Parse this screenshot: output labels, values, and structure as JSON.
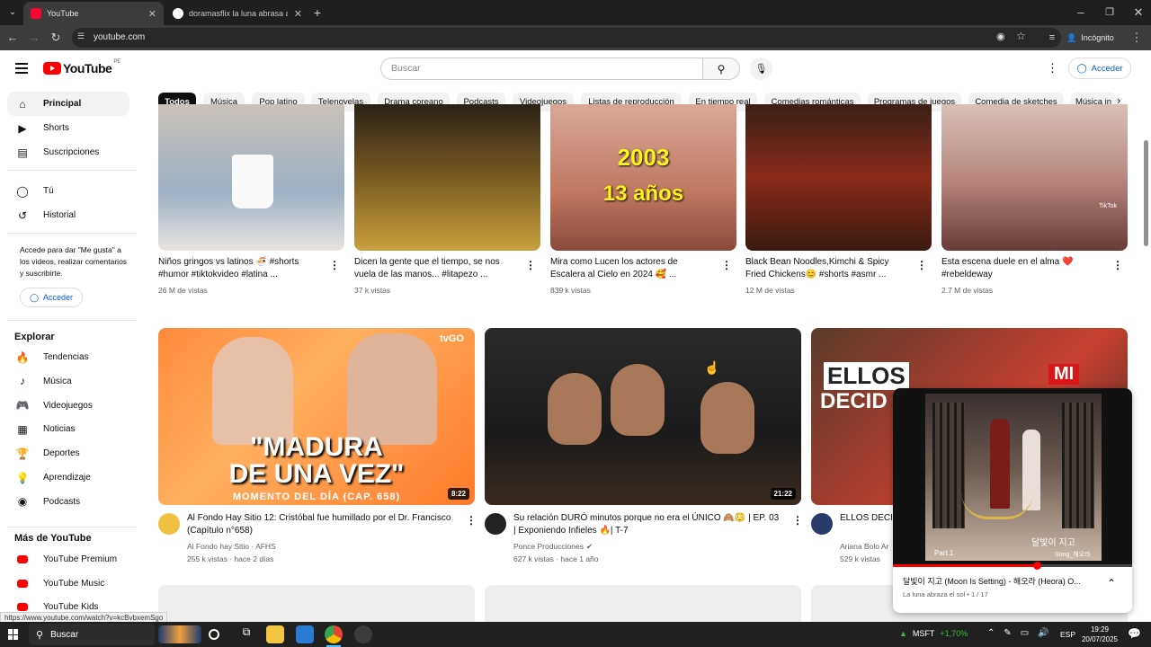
{
  "browser": {
    "tabs": [
      {
        "title": "YouTube",
        "active": true
      },
      {
        "title": "doramasflix la luna abrasa al so",
        "active": false
      }
    ],
    "url": "youtube.com",
    "profile": "Incógnito"
  },
  "header": {
    "logo_text": "YouTube",
    "country": "PE",
    "search_placeholder": "Buscar",
    "signin_label": "Acceder"
  },
  "sidebar": {
    "top": [
      {
        "label": "Principal",
        "icon": "home-icon",
        "selected": true
      },
      {
        "label": "Shorts",
        "icon": "shorts-icon"
      },
      {
        "label": "Suscripciones",
        "icon": "subscriptions-icon"
      }
    ],
    "you": [
      {
        "label": "Tú",
        "icon": "user-icon"
      },
      {
        "label": "Historial",
        "icon": "history-icon"
      }
    ],
    "signin_prompt": "Accede para dar \"Me gusta\" a los videos, realizar comentarios y suscribirte.",
    "signin_button": "Acceder",
    "explore_title": "Explorar",
    "explore": [
      {
        "label": "Tendencias",
        "icon": "trending-icon"
      },
      {
        "label": "Música",
        "icon": "music-icon"
      },
      {
        "label": "Videojuegos",
        "icon": "gaming-icon"
      },
      {
        "label": "Noticias",
        "icon": "news-icon"
      },
      {
        "label": "Deportes",
        "icon": "sports-icon"
      },
      {
        "label": "Aprendizaje",
        "icon": "learning-icon"
      },
      {
        "label": "Podcasts",
        "icon": "podcasts-icon"
      }
    ],
    "more_title": "Más de YouTube",
    "more": [
      {
        "label": "YouTube Premium"
      },
      {
        "label": "YouTube Music"
      },
      {
        "label": "YouTube Kids"
      }
    ]
  },
  "chips": [
    "Todos",
    "Música",
    "Pop latino",
    "Telenovelas",
    "Drama coreano",
    "Podcasts",
    "Videojuegos",
    "Listas de reproducción",
    "En tiempo real",
    "Comedias románticas",
    "Programas de juegos",
    "Comedia de sketches",
    "Música in"
  ],
  "shorts": [
    {
      "title": "Niños gringos vs latinos 🍜 #shorts #humor #tiktokvideo #latina ...",
      "views": "26 M de vistas"
    },
    {
      "title": "Dicen la gente que el tiempo, se nos vuela de las manos... #litapezo ...",
      "views": "37 k vistas"
    },
    {
      "title": "Mira como Lucen los actores de Escalera al Cielo en 2024 🥰 ...",
      "views": "839 k vistas",
      "overlay1": "2003",
      "overlay2": "13 años"
    },
    {
      "title": "Black Bean Noodles,Kimchi & Spicy Fried Chickens😊 #shorts #asmr ...",
      "views": "12 M de vistas"
    },
    {
      "title": "Esta escena duele en el alma ❤️ #rebeldeway",
      "views": "2.7 M de vistas",
      "overlay1": "TikTok"
    }
  ],
  "videos": [
    {
      "title": "Al Fondo Hay Sitio 12: Cristóbal fue humillado por el Dr. Francisco (Capítulo n°658)",
      "channel": "Al Fondo hay Sitio · AFHS",
      "meta": "255 k vistas · hace 2 días",
      "duration": "8:22",
      "thumb_line1": "\"MADURA",
      "thumb_line2": "DE UNA VEZ\"",
      "thumb_caption": "MOMENTO DEL DÍA (CAP. 658)",
      "thumb_badge": "tvGO"
    },
    {
      "title": "Su relación DURÓ minutos porque no era el ÚNICO 🙈😳 | EP. 03 | Exponiendo Infieles 🔥| T-7",
      "channel": "Ponce Producciones",
      "meta": "627 k vistas · hace 1 año",
      "duration": "21:22"
    },
    {
      "title": "ELLOS DECID",
      "channel": "Ariana Bolo Ar",
      "meta": "529 k vistas",
      "thumb_line1": "ELLOS",
      "thumb_line2": "DECID",
      "thumb_badge": "MI"
    }
  ],
  "miniplayer": {
    "title": "달빛이 지고 (Moon Is Setting) - 해오라 (Heora) O...",
    "subtitle": "La luna abraza el sol • 1 / 17",
    "art_part": "Part.1",
    "art_song": "Song_해오라",
    "art_korean": "달빛이 지고",
    "progress": 0.6
  },
  "status_url": "https://www.youtube.com/watch?v=kcBvbxemSgo",
  "taskbar": {
    "search": "Buscar",
    "stock": "MSFT",
    "stock_change": "+1,70%",
    "lang": "ESP",
    "time": "19:29",
    "date": "20/07/2025"
  }
}
